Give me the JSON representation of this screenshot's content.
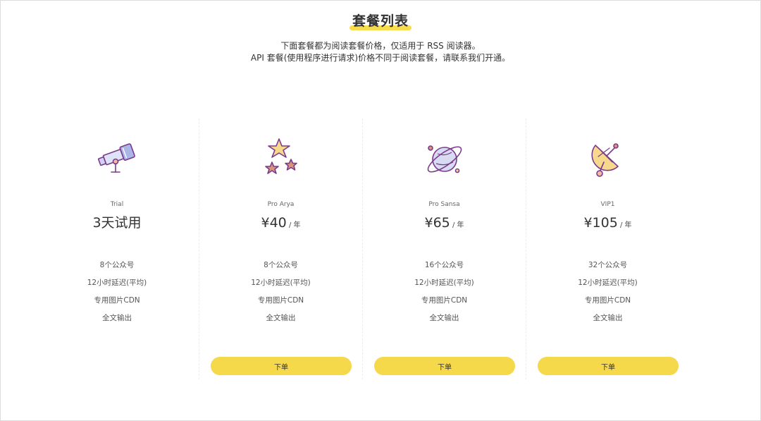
{
  "page": {
    "title": "套餐列表",
    "subtitle_line1": "下面套餐都为阅读套餐价格，仅适用于 RSS 阅读器。",
    "subtitle_line2": "API 套餐(使用程序进行请求)价格不同于阅读套餐，请联系我们开通。"
  },
  "colors": {
    "accent": "#f6d84b",
    "icon_stroke": "#7b3a8c"
  },
  "plans": [
    {
      "icon": "telescope-icon",
      "name": "Trial",
      "price": "3天试用",
      "unit": "",
      "features": [
        "8个公众号",
        "12小时延迟(平均)",
        "专用图片CDN",
        "全文输出"
      ],
      "button": ""
    },
    {
      "icon": "stars-icon",
      "name": "Pro Arya",
      "price": "¥40",
      "unit": " / 年",
      "features": [
        "8个公众号",
        "12小时延迟(平均)",
        "专用图片CDN",
        "全文输出"
      ],
      "button": "下单"
    },
    {
      "icon": "planet-icon",
      "name": "Pro Sansa",
      "price": "¥65",
      "unit": " / 年",
      "features": [
        "16个公众号",
        "12小时延迟(平均)",
        "专用图片CDN",
        "全文输出"
      ],
      "button": "下单"
    },
    {
      "icon": "satellite-dish-icon",
      "name": "VIP1",
      "price": "¥105",
      "unit": " / 年",
      "features": [
        "32个公众号",
        "12小时延迟(平均)",
        "专用图片CDN",
        "全文输出"
      ],
      "button": "下单"
    }
  ]
}
